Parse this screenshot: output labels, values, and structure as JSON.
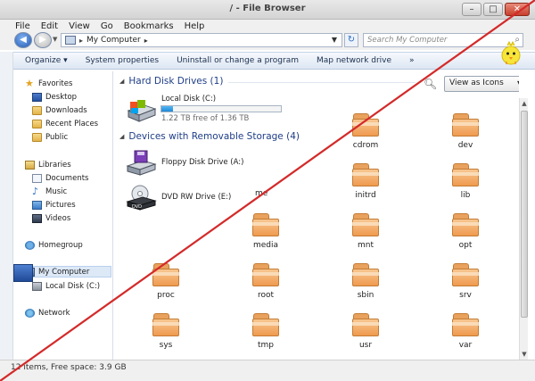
{
  "window": {
    "title": "/ - File Browser"
  },
  "menu": [
    "File",
    "Edit",
    "View",
    "Go",
    "Bookmarks",
    "Help"
  ],
  "address": {
    "path": "My Computer",
    "search_placeholder": "Search My Computer"
  },
  "toolbar": {
    "items": [
      "Organize ▾",
      "System properties",
      "Uninstall or change a program",
      "Map network drive",
      "»"
    ]
  },
  "sidebar": {
    "favorites": {
      "label": "Favorites",
      "items": [
        "Desktop",
        "Downloads",
        "Recent Places",
        "Public"
      ]
    },
    "libraries": {
      "label": "Libraries",
      "items": [
        "Documents",
        "Music",
        "Pictures",
        "Videos"
      ]
    },
    "homegroup": "Homegroup",
    "computer": {
      "label": "My Computer",
      "items": [
        "Local Disk (C:)"
      ]
    },
    "network": "Network"
  },
  "main": {
    "hard_drives": {
      "header": "Hard Disk Drives (1)",
      "drive": {
        "name": "Local Disk (C:)",
        "free": "1.22 TB free of 1.36 TB",
        "used_fraction": 0.1
      }
    },
    "removable": {
      "header": "Devices with Removable Storage (4)",
      "drives": [
        "Floppy Disk Drive (A:)",
        "DVD RW Drive (E:)"
      ]
    },
    "view_select": "View as Icons",
    "folders": [
      "cdrom",
      "dev",
      "initrd",
      "lib",
      "media",
      "mnt",
      "opt",
      "proc",
      "root",
      "sbin",
      "srv",
      "sys",
      "tmp",
      "usr",
      "var"
    ],
    "partial_labels": [
      "me"
    ]
  },
  "statusbar": "12 items, Free space: 3.9 GB",
  "colors": {
    "header_blue": "#1e3d87",
    "folder_orange": "#ef9a4f",
    "diagonal_red": "#d42a2a"
  }
}
